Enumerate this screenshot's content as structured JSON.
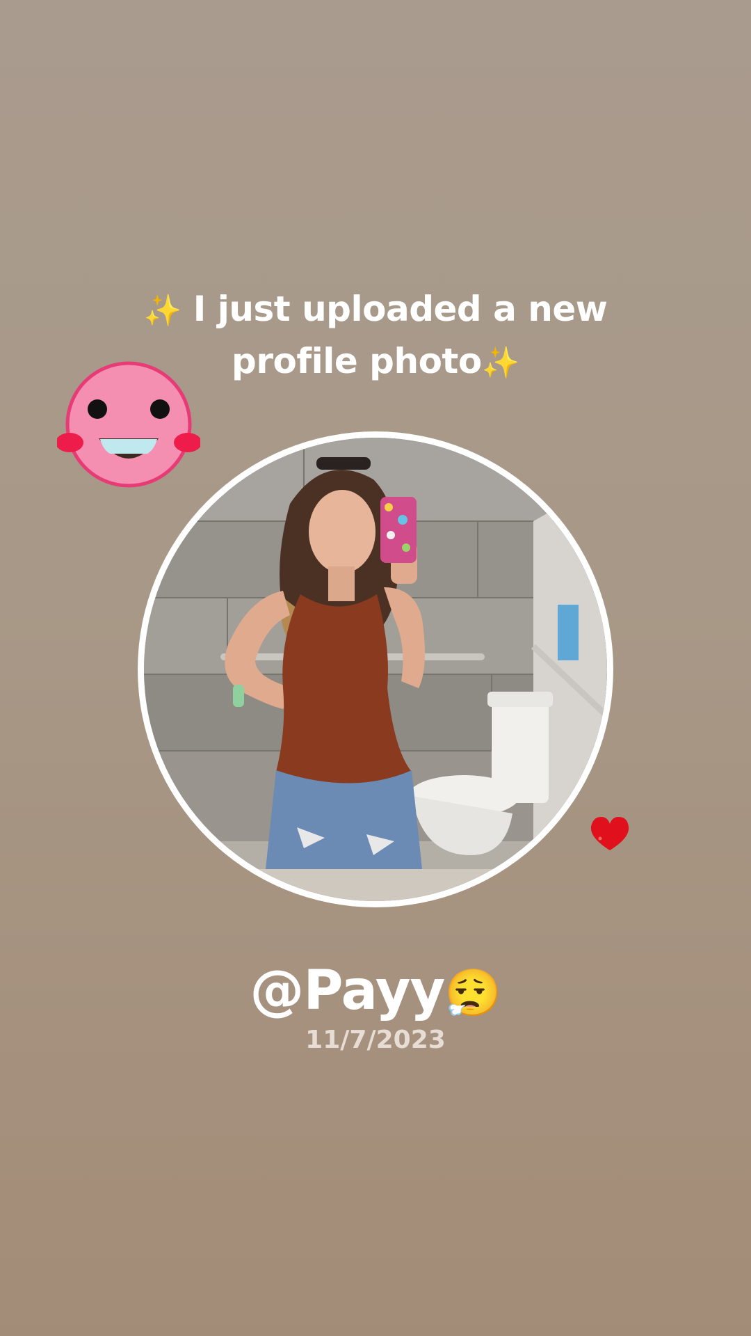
{
  "story": {
    "headline_prefix_emoji": "✨",
    "headline_text": "I just uploaded a new profile photo",
    "headline_suffix_emoji": "✨",
    "username": "@Payy",
    "username_emoji": "😮‍💨",
    "date": "11/7/2023"
  },
  "stickers": {
    "smiley": "smiley-face-sticker",
    "heart": "red-heart-sticker"
  },
  "colors": {
    "background_top": "#a99b8e",
    "background_bottom": "#a38c77",
    "smiley_pink": "#f48fb1",
    "heart_red": "#e0101c"
  }
}
